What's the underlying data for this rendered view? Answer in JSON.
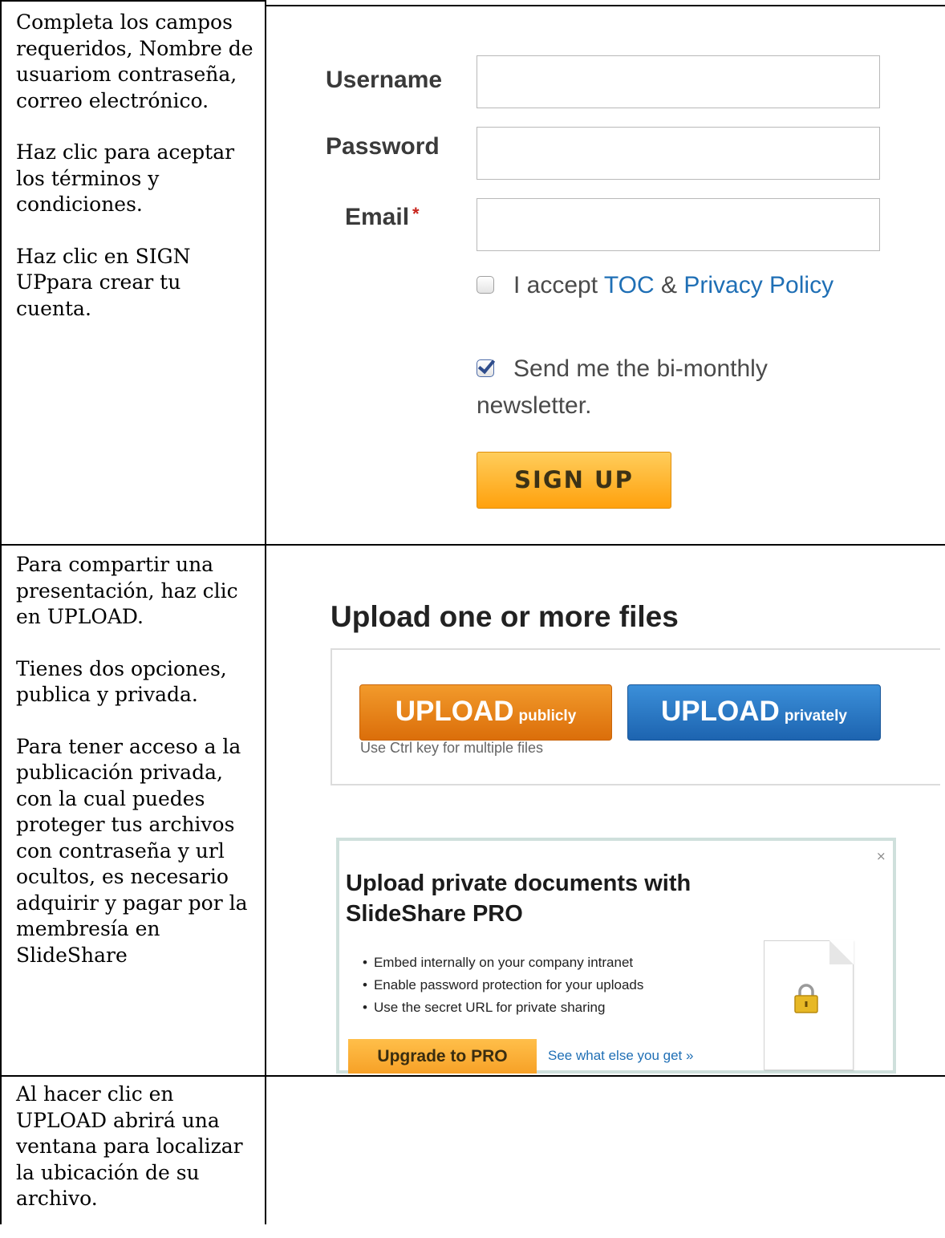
{
  "rows": [
    {
      "paragraphs": [
        "Completa los campos requeridos, Nombre de usuariom contraseña, correo electrónico.",
        "Haz clic para aceptar los términos y condiciones.",
        "Haz clic en SIGN UPpara crear tu cuenta."
      ]
    },
    {
      "paragraphs": [
        "Para compartir una presentación, haz clic en UPLOAD.",
        "Tienes dos opciones, publica y privada.",
        "Para tener acceso a la publicación privada, con la cual puedes proteger tus archivos con contraseña y url ocultos, es necesario adquirir y pagar por la membresía en SlideShare"
      ]
    },
    {
      "paragraphs": [
        "Al hacer clic en UPLOAD abrirá una ventana para localizar la ubicación de su archivo."
      ]
    }
  ],
  "signup_form": {
    "username_label": "Username",
    "password_label": "Password",
    "email_label": "Email",
    "required_mark": "*",
    "username_value": "",
    "password_value": "",
    "email_value": "",
    "accept_prefix": "I accept",
    "toc_link": "TOC",
    "amp": "&",
    "privacy_link": "Privacy Policy",
    "accept_checked": false,
    "newsletter_label": "Send me the bi-monthly newsletter.",
    "newsletter_checked": true,
    "submit_label": "SIGN UP"
  },
  "upload": {
    "heading": "Upload one or more files",
    "public_main": "UPLOAD",
    "public_sub": "publicly",
    "private_main": "UPLOAD",
    "private_sub": "privately",
    "hint": "Use Ctrl key for multiple files"
  },
  "pro_box": {
    "close": "×",
    "title": "Upload private documents with SlideShare PRO",
    "bullets": [
      "Embed internally on your company intranet",
      "Enable password protection for your uploads",
      "Use the secret URL for private sharing"
    ],
    "upgrade_label": "Upgrade to PRO",
    "link_label": "See what else you get »"
  },
  "colors": {
    "link_blue": "#1f6fb5",
    "orange_button": "#ffa10d",
    "blue_button": "#1d64b0",
    "required_red": "#c8241c"
  }
}
